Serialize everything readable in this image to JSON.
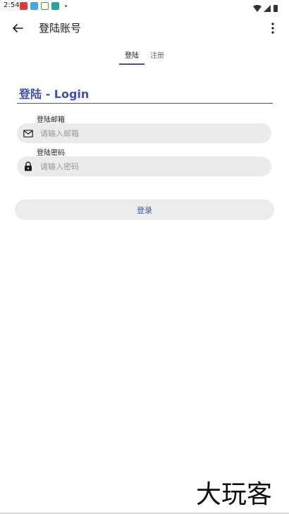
{
  "status_bar": {
    "time": "2:54",
    "icons": [
      "notification-red-icon",
      "app-blue-icon",
      "app-green-icon",
      "app-teal-icon",
      "dot-icon"
    ],
    "right_icons": [
      "wifi-icon",
      "signal-icon",
      "battery-icon"
    ],
    "colors": {
      "red": "#e53935",
      "blue": "#42a5f5",
      "green": "#43a047",
      "teal": "#26a69a"
    }
  },
  "app_bar": {
    "title": "登陆账号",
    "back_icon": "arrow-back-icon",
    "more_icon": "more-vert-icon"
  },
  "tabs": [
    {
      "label": "登陆",
      "selected": true
    },
    {
      "label": "注册",
      "selected": false
    }
  ],
  "form": {
    "heading": "登陆 - Login",
    "email": {
      "label": "登陆邮箱",
      "placeholder": "请输入邮箱",
      "value": "",
      "icon": "mail-icon"
    },
    "password": {
      "label": "登陆密码",
      "placeholder": "请输入密码",
      "value": "",
      "icon": "lock-icon"
    },
    "submit_label": "登录"
  },
  "watermark": "大玩客",
  "colors": {
    "accent": "#3f51b5",
    "field_bg": "#ebebeb",
    "button_bg": "#ececec"
  }
}
